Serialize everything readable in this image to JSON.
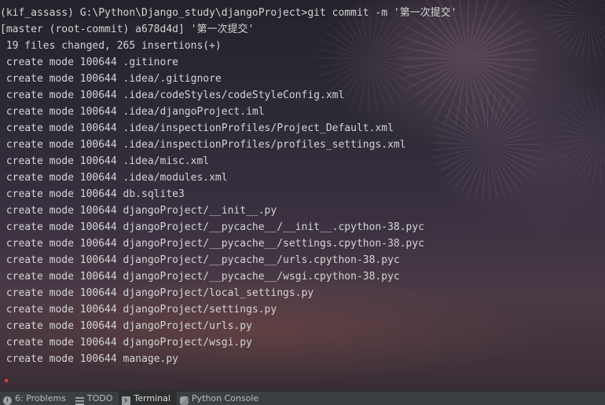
{
  "terminal": {
    "lines": [
      "(kif_assass) G:\\Python\\Django_study\\djangoProject>git commit -m '第一次提交'",
      "[master (root-commit) a678d4d] '第一次提交'",
      " 19 files changed, 265 insertions(+)",
      " create mode 100644 .gitinore",
      " create mode 100644 .idea/.gitignore",
      " create mode 100644 .idea/codeStyles/codeStyleConfig.xml",
      " create mode 100644 .idea/djangoProject.iml",
      " create mode 100644 .idea/inspectionProfiles/Project_Default.xml",
      " create mode 100644 .idea/inspectionProfiles/profiles_settings.xml",
      " create mode 100644 .idea/misc.xml",
      " create mode 100644 .idea/modules.xml",
      " create mode 100644 db.sqlite3",
      " create mode 100644 djangoProject/__init__.py",
      " create mode 100644 djangoProject/__pycache__/__init__.cpython-38.pyc",
      " create mode 100644 djangoProject/__pycache__/settings.cpython-38.pyc",
      " create mode 100644 djangoProject/__pycache__/urls.cpython-38.pyc",
      " create mode 100644 djangoProject/__pycache__/wsgi.cpython-38.pyc",
      " create mode 100644 djangoProject/local_settings.py",
      " create mode 100644 djangoProject/settings.py",
      " create mode 100644 djangoProject/urls.py",
      " create mode 100644 djangoProject/wsgi.py",
      " create mode 100644 manage.py"
    ],
    "text_color": "#d4d4d4"
  },
  "toolwindow_bar": {
    "tabs": [
      {
        "label": "6: Problems",
        "icon": "problems-icon",
        "active": false
      },
      {
        "label": "TODO",
        "icon": "todo-icon",
        "active": false
      },
      {
        "label": "Terminal",
        "icon": "terminal-icon",
        "active": true
      },
      {
        "label": "Python Console",
        "icon": "python-console-icon",
        "active": false
      }
    ]
  }
}
